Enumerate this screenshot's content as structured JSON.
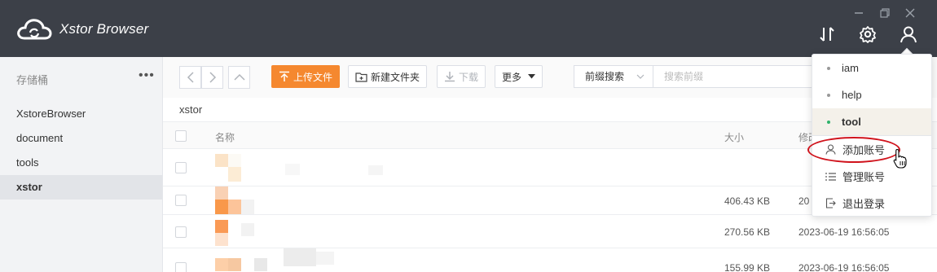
{
  "app": {
    "title": "Xstor Browser"
  },
  "window_controls": [
    "minimize-icon",
    "restore-icon",
    "close-icon"
  ],
  "header_icons": [
    "transfer-icon",
    "gear-icon",
    "user-icon"
  ],
  "sidebar": {
    "header": "存储桶",
    "more": "•••",
    "items": [
      {
        "label": "XstoreBrowser",
        "active": false
      },
      {
        "label": "document",
        "active": false
      },
      {
        "label": "tools",
        "active": false
      },
      {
        "label": "xstor",
        "active": true
      }
    ]
  },
  "toolbar": {
    "upload": "上传文件",
    "new_folder": "新建文件夹",
    "download": "下载",
    "more": "更多",
    "search_mode": "前缀搜索",
    "search_placeholder": "搜索前缀"
  },
  "breadcrumb": "xstor",
  "table": {
    "columns": {
      "name": "名称",
      "size": "大小",
      "modified": "修改"
    },
    "rows": [
      {
        "size": "",
        "modified": ""
      },
      {
        "size": "406.43 KB",
        "modified": "20"
      },
      {
        "size": "270.56 KB",
        "modified": "2023-06-19 16:56:05"
      },
      {
        "size": "155.99 KB",
        "modified": "2023-06-19 16:56:05"
      }
    ]
  },
  "account_menu": {
    "accounts": [
      {
        "label": "iam",
        "active": false
      },
      {
        "label": "help",
        "active": false
      },
      {
        "label": "tool",
        "active": true
      }
    ],
    "add_account": "添加账号",
    "manage_accounts": "管理账号",
    "logout": "退出登录"
  },
  "colors": {
    "titlebar": "#3c4048",
    "accent": "#f5882f",
    "active_dot": "#2fb36b",
    "highlight": "#d0131c"
  }
}
